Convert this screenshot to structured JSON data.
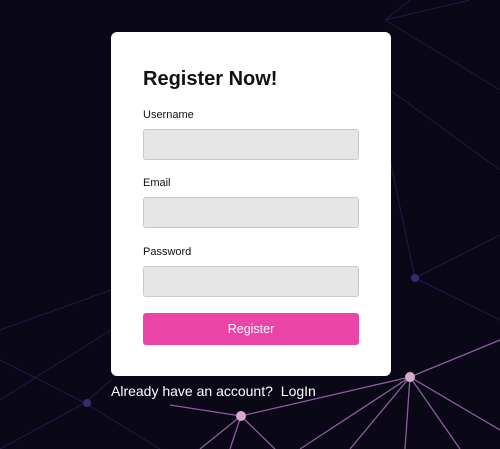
{
  "form": {
    "title": "Register Now!",
    "username_label": "Username",
    "username_value": "",
    "email_label": "Email",
    "email_value": "",
    "password_label": "Password",
    "password_value": "",
    "register_label": "Register"
  },
  "footer": {
    "prompt": "Already have an account?",
    "login_label": "LogIn"
  },
  "colors": {
    "background": "#0a0717",
    "accent": "#ea45a6",
    "network_lines": "#9b6fa8",
    "network_nodes": "#d6a8cc"
  }
}
